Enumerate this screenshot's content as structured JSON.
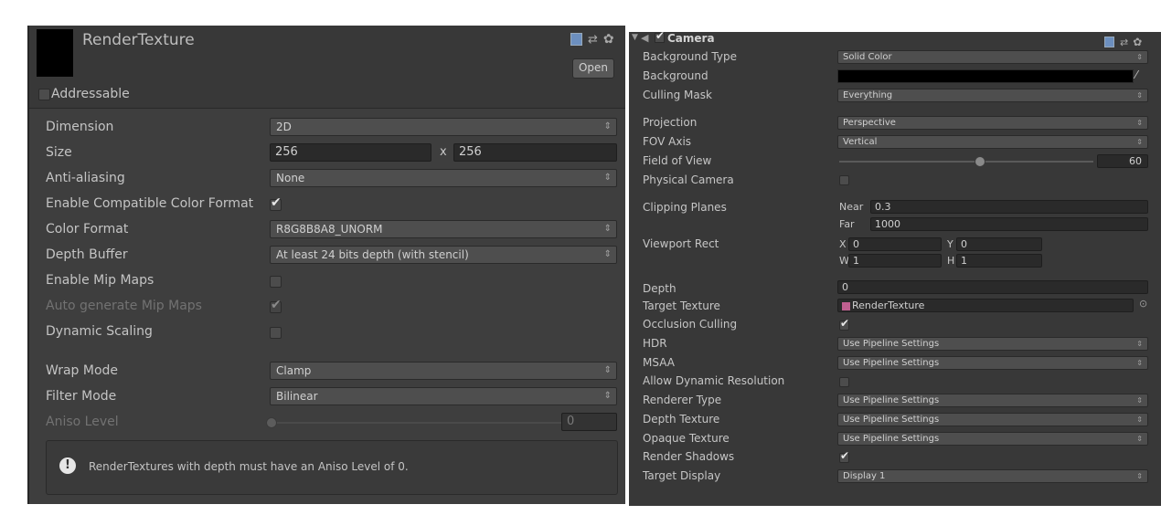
{
  "left": {
    "title": "RenderTexture",
    "open_label": "Open",
    "addressable_label": "Addressable",
    "rows": {
      "dimension": {
        "label": "Dimension",
        "value": "2D"
      },
      "size": {
        "label": "Size",
        "width": "256",
        "x": "x",
        "height": "256"
      },
      "anti_aliasing": {
        "label": "Anti-aliasing",
        "value": "None"
      },
      "compat_color": {
        "label": "Enable Compatible Color Format"
      },
      "color_format": {
        "label": "Color Format",
        "value": "R8G8B8A8_UNORM"
      },
      "depth_buffer": {
        "label": "Depth Buffer",
        "value": "At least 24 bits depth (with stencil)"
      },
      "mip_maps": {
        "label": "Enable Mip Maps"
      },
      "auto_mip": {
        "label": "Auto generate Mip Maps"
      },
      "dynamic_scaling": {
        "label": "Dynamic Scaling"
      },
      "wrap_mode": {
        "label": "Wrap Mode",
        "value": "Clamp"
      },
      "filter_mode": {
        "label": "Filter Mode",
        "value": "Bilinear"
      },
      "aniso": {
        "label": "Aniso Level",
        "value": "0"
      }
    },
    "warning": "RenderTextures with depth must have an Aniso Level of 0."
  },
  "right": {
    "title": "Camera",
    "rows": {
      "bg_type": {
        "label": "Background Type",
        "value": "Solid Color"
      },
      "background": {
        "label": "Background"
      },
      "culling": {
        "label": "Culling Mask",
        "value": "Everything"
      },
      "projection": {
        "label": "Projection",
        "value": "Perspective"
      },
      "fov_axis": {
        "label": "FOV Axis",
        "value": "Vertical"
      },
      "fov": {
        "label": "Field of View",
        "value": "60"
      },
      "physical": {
        "label": "Physical Camera"
      },
      "clipping": {
        "label": "Clipping Planes",
        "near_label": "Near",
        "near": "0.3",
        "far_label": "Far",
        "far": "1000"
      },
      "viewport": {
        "label": "Viewport Rect",
        "x_label": "X",
        "x": "0",
        "y_label": "Y",
        "y": "0",
        "w_label": "W",
        "w": "1",
        "h_label": "H",
        "h": "1"
      },
      "depth": {
        "label": "Depth",
        "value": "0"
      },
      "target_texture": {
        "label": "Target Texture",
        "value": "RenderTexture"
      },
      "occlusion": {
        "label": "Occlusion Culling"
      },
      "hdr": {
        "label": "HDR",
        "value": "Use Pipeline Settings"
      },
      "msaa": {
        "label": "MSAA",
        "value": "Use Pipeline Settings"
      },
      "dyn_res": {
        "label": "Allow Dynamic Resolution"
      },
      "renderer_type": {
        "label": "Renderer Type",
        "value": "Use Pipeline Settings"
      },
      "depth_texture": {
        "label": "Depth Texture",
        "value": "Use Pipeline Settings"
      },
      "opaque_texture": {
        "label": "Opaque Texture",
        "value": "Use Pipeline Settings"
      },
      "shadows": {
        "label": "Render Shadows"
      },
      "target_display": {
        "label": "Target Display",
        "value": "Display 1"
      }
    },
    "field_of_view_fraction": 0.55
  },
  "colors": {
    "panel": "#383838",
    "field": "#2a2a2a",
    "dropdown": "#4e4e4e",
    "text": "#c4c4c4"
  }
}
